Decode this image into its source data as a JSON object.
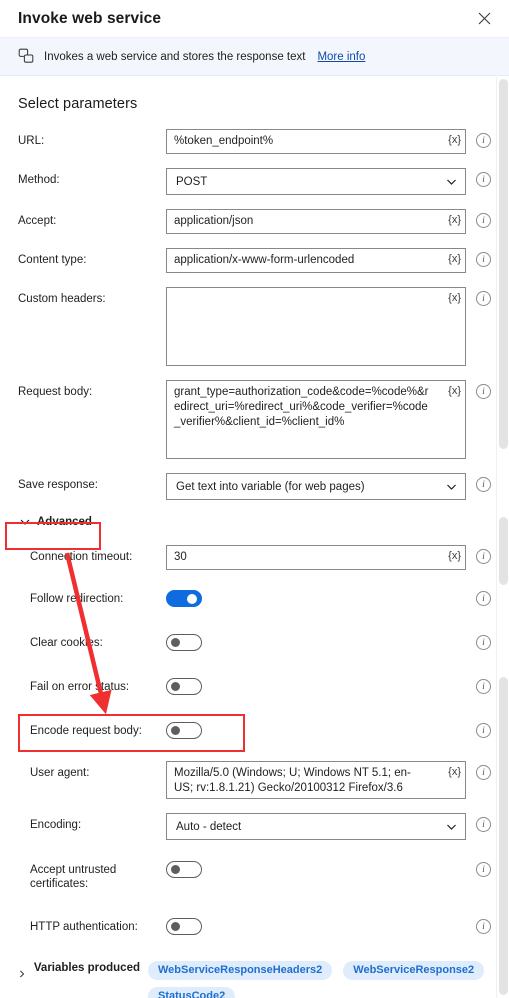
{
  "dialog": {
    "title": "Invoke web service",
    "close_icon": "close-icon"
  },
  "banner": {
    "icon": "web-service-icon",
    "text": "Invokes a web service and stores the response text",
    "link_label": "More info"
  },
  "section": {
    "title": "Select parameters"
  },
  "fields": {
    "url": {
      "label": "URL:",
      "value": "%token_endpoint%",
      "var_btn": "{x}",
      "type": "text"
    },
    "method": {
      "label": "Method:",
      "value": "POST",
      "type": "select"
    },
    "accept": {
      "label": "Accept:",
      "value": "application/json",
      "var_btn": "{x}",
      "type": "text"
    },
    "content_type": {
      "label": "Content type:",
      "value": "application/x-www-form-urlencoded",
      "var_btn": "{x}",
      "type": "text"
    },
    "custom_headers": {
      "label": "Custom headers:",
      "value": "",
      "var_btn": "{x}",
      "type": "textarea"
    },
    "request_body": {
      "label": "Request body:",
      "value": "grant_type=authorization_code&code=%code%&redirect_uri=%redirect_uri%&code_verifier=%code_verifier%&client_id=%client_id%",
      "var_btn": "{x}",
      "type": "textarea"
    },
    "save_response": {
      "label": "Save response:",
      "value": "Get text into variable (for web pages)",
      "type": "select"
    },
    "connection_timeout": {
      "label": "Connection timeout:",
      "value": "30",
      "var_btn": "{x}",
      "type": "text"
    },
    "follow_redirection": {
      "label": "Follow redirection:",
      "value": "on",
      "type": "toggle"
    },
    "clear_cookies": {
      "label": "Clear cookies:",
      "value": "off",
      "type": "toggle"
    },
    "fail_on_error_status": {
      "label": "Fail on error status:",
      "value": "off",
      "type": "toggle"
    },
    "encode_request_body": {
      "label": "Encode request body:",
      "value": "off",
      "type": "toggle"
    },
    "user_agent": {
      "label": "User agent:",
      "value": "Mozilla/5.0 (Windows; U; Windows NT 5.1; en-US; rv:1.8.1.21) Gecko/20100312 Firefox/3.6",
      "var_btn": "{x}",
      "type": "textarea"
    },
    "encoding": {
      "label": "Encoding:",
      "value": "Auto - detect",
      "type": "select"
    },
    "accept_untrusted_certificates": {
      "label": "Accept untrusted certificates:",
      "value": "off",
      "type": "toggle"
    },
    "http_authentication": {
      "label": "HTTP authentication:",
      "value": "off",
      "type": "toggle"
    }
  },
  "advanced": {
    "label": "Advanced",
    "expanded": true,
    "chevron": "chevron-down-icon"
  },
  "variables_produced": {
    "label": "Variables produced",
    "chevron": "chevron-right-icon",
    "items": [
      "WebServiceResponseHeaders2",
      "WebServiceResponse2",
      "StatusCode2"
    ]
  },
  "annotations": {
    "color": "#f03030",
    "boxes": [
      {
        "name": "advanced-highlight"
      },
      {
        "name": "encode-request-body-highlight"
      }
    ],
    "arrow": {
      "name": "pointer-arrow"
    }
  },
  "colors": {
    "accent_blue": "#0f6cde",
    "link_blue": "#0f4ba8",
    "pill_bg": "#dfecfb",
    "pill_text": "#1f6fd0",
    "banner_bg": "#f3f7fd",
    "annotation_red": "#f03030",
    "field_border": "#8a8886"
  }
}
